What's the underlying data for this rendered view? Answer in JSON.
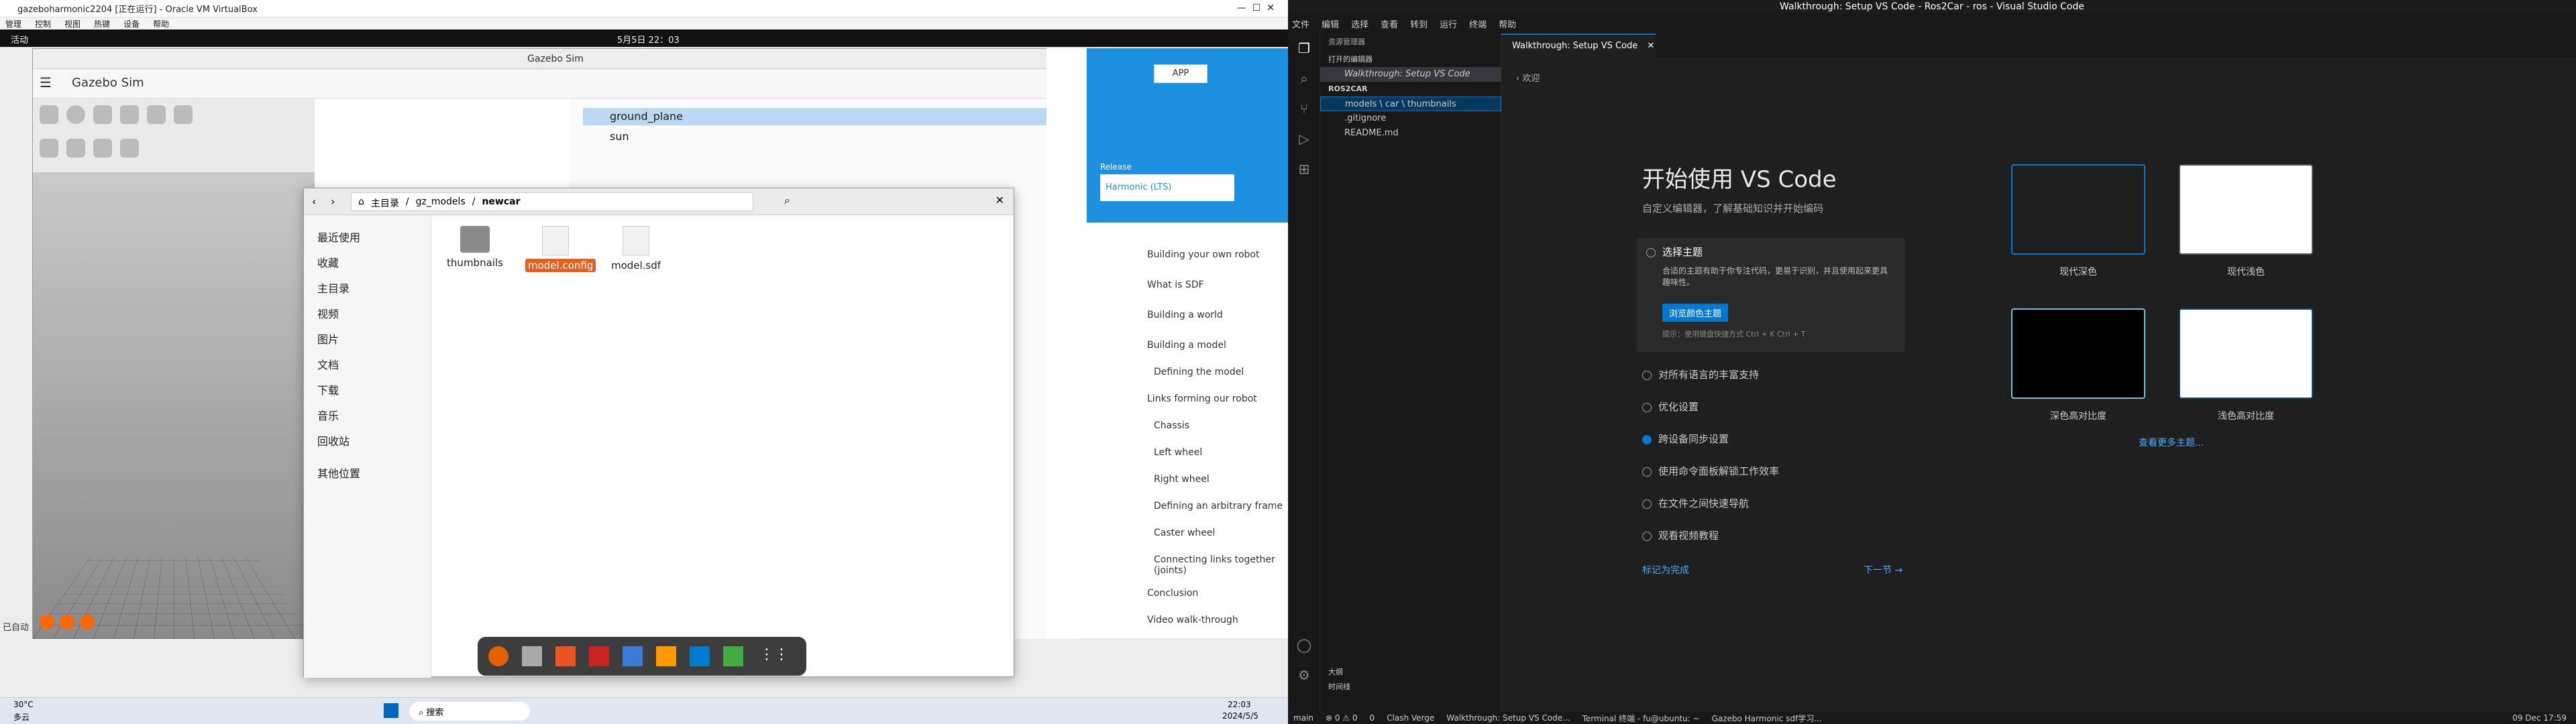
{
  "left": {
    "vbox_title": "gazeboharmonic2204 [正在运行] - Oracle VM VirtualBox",
    "vbox_menu": [
      "管理",
      "控制",
      "视图",
      "热键",
      "设备",
      "帮助"
    ],
    "gnome_activities": "活动",
    "gnome_clock": "5月5日 22：03",
    "gazebo_window_title": "Gazebo Sim",
    "gazebo_app_title": "Gazebo Sim",
    "tree": [
      "ground_plane",
      "sun"
    ],
    "web_badge": "Harmonic (LTS)",
    "web_release_label": "Release",
    "web_app_btn": "APP",
    "web_nav": [
      "Building your own robot",
      "What is SDF",
      "Building a world",
      "Building a model",
      "Defining the model",
      "Links forming our robot",
      "Chassis",
      "Left wheel",
      "Right wheel",
      "Defining an arbitrary frame",
      "Caster wheel",
      "Connecting links together (joints)",
      "Conclusion",
      "Video walk-through"
    ],
    "fm_breadcrumb": [
      "主目录",
      "gz_models",
      "newcar"
    ],
    "fm_side": [
      "最近使用",
      "收藏",
      "主目录",
      "视频",
      "图片",
      "文档",
      "下载",
      "音乐",
      "回收站",
      "其他位置"
    ],
    "fm_files": [
      "thumbnails",
      "model.config",
      "model.sdf"
    ],
    "taskbar_weather": "30°C",
    "taskbar_weather_sub": "多云",
    "taskbar_search": "搜索",
    "taskbar_time": "22:03",
    "taskbar_date": "2024/5/5",
    "status_text": "已自动"
  },
  "right": {
    "title": "Walkthrough: Setup VS Code - Ros2Car - ros - Visual Studio Code",
    "menu": [
      "文件",
      "编辑",
      "选择",
      "查看",
      "转到",
      "运行",
      "终端",
      "帮助"
    ],
    "explorer_header": "资源管理器",
    "open_editors": "打开的编辑器",
    "open_file": "Walkthrough: Setup VS Code",
    "workspace": "ROS2CAR",
    "tree": [
      "models \\ car \\ thumbnails",
      ".gitignore",
      "README.md"
    ],
    "outline": "大纲",
    "timeline": "时间线",
    "tab_label": "Walkthrough: Setup VS Code",
    "back_link": "欢迎",
    "walk_title": "开始使用 VS Code",
    "walk_sub": "自定义编辑器，了解基础知识并开始编码",
    "step_active_title": "选择主题",
    "step_active_desc": "合适的主题有助于你专注代码，更易于识别，并且使用起来更具趣味性。",
    "step_btn": "浏览颜色主题",
    "step_hint": "提示：使用键盘快捷方式 Ctrl + K Ctrl + T",
    "steps": [
      "对所有语言的丰富支持",
      "优化设置",
      "跨设备同步设置",
      "使用命令面板解锁工作效率",
      "在文件之间快速导航",
      "观看视频教程"
    ],
    "mark_done": "标记为完成",
    "next": "下一节 →",
    "themes": [
      "现代深色",
      "现代浅色",
      "深色高对比度",
      "浅色高对比度"
    ],
    "more_themes": "查看更多主题...",
    "status_branch": "main",
    "status_counts": "⊗ 0 ⚠ 0",
    "status_ports": "0",
    "taskbar_items": [
      "Clash Verge",
      "Walkthrough: Setup VS Code...",
      "Terminal 终端 - fu@ubuntu: ~",
      "Gazebo Harmonic sdf学习..."
    ],
    "taskbar_time": "09 Dec 17:59"
  }
}
